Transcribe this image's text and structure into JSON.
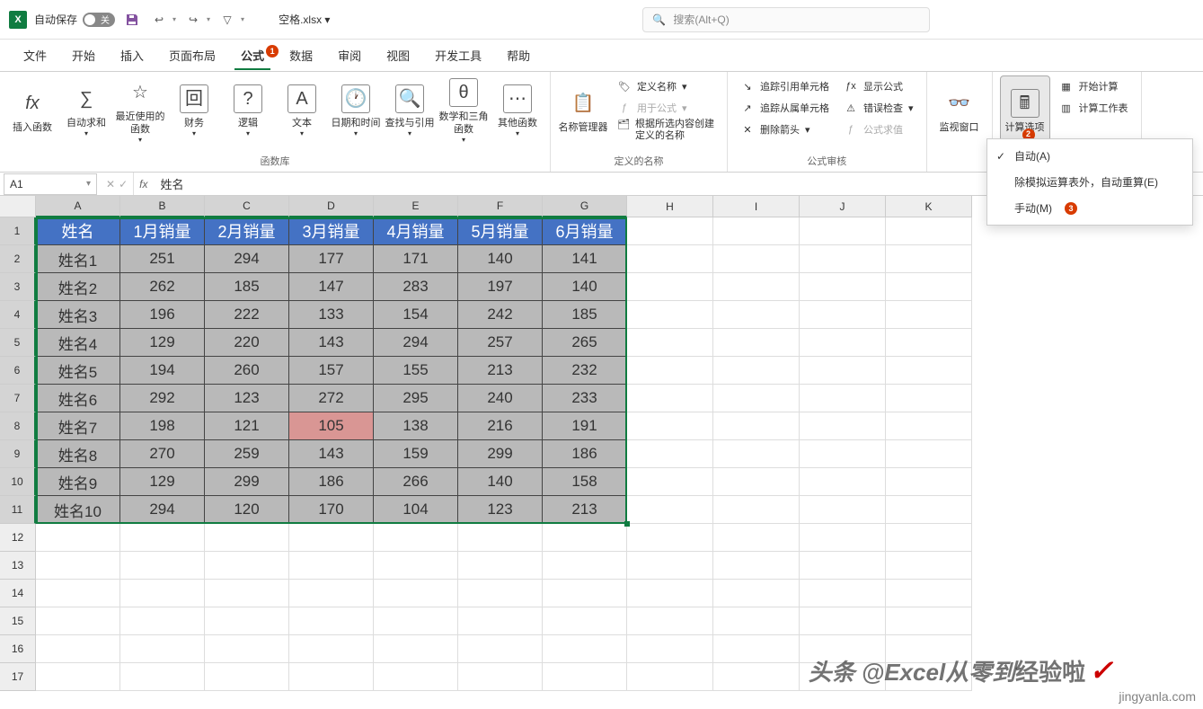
{
  "title_bar": {
    "autosave_label": "自动保存",
    "autosave_state": "关",
    "filename": "空格.xlsx ▾",
    "search_placeholder": "搜索(Alt+Q)"
  },
  "menu": {
    "tabs": [
      "文件",
      "开始",
      "插入",
      "页面布局",
      "公式",
      "数据",
      "审阅",
      "视图",
      "开发工具",
      "帮助"
    ],
    "active_index": 4,
    "badge_on": 4,
    "badge_text": "1"
  },
  "ribbon": {
    "insert_fn": "插入函数",
    "autosum": "自动求和",
    "recent": "最近使用的函数",
    "financial": "财务",
    "logical": "逻辑",
    "text": "文本",
    "datetime": "日期和时间",
    "lookup": "查找与引用",
    "math": "数学和三角函数",
    "more": "其他函数",
    "group_fnlib": "函数库",
    "name_mgr": "名称管理器",
    "define_name": "定义名称",
    "use_in_formula": "用于公式",
    "create_from_sel": "根据所选内容创建定义的名称",
    "group_names": "定义的名称",
    "trace_prec": "追踪引用单元格",
    "trace_dep": "追踪从属单元格",
    "remove_arrows": "删除箭头",
    "show_formulas": "显示公式",
    "error_check": "错误检查",
    "evaluate": "公式求值",
    "group_audit": "公式审核",
    "watch": "监视窗口",
    "calc_options": "计算选项",
    "calc_options_badge": "2",
    "calc_now": "开始计算",
    "calc_sheet": "计算工作表"
  },
  "dropdown": {
    "auto": "自动(A)",
    "except_tables": "除模拟运算表外，自动重算(E)",
    "manual": "手动(M)",
    "manual_badge": "3"
  },
  "formula_bar": {
    "name_box": "A1",
    "formula": "姓名"
  },
  "grid": {
    "col_letters": [
      "A",
      "B",
      "C",
      "D",
      "E",
      "F",
      "G",
      "H",
      "I",
      "J",
      "K"
    ],
    "data_cols": 7,
    "col_width_data": 94,
    "col_width_empty": 96,
    "row_heights": {
      "header": 24,
      "data": 31,
      "empty": 31
    },
    "selected_rows": 11,
    "empty_rows": 6,
    "headers": [
      "姓名",
      "1月销量",
      "2月销量",
      "3月销量",
      "4月销量",
      "5月销量",
      "6月销量"
    ],
    "rows": [
      [
        "姓名1",
        "251",
        "294",
        "177",
        "171",
        "140",
        "141"
      ],
      [
        "姓名2",
        "262",
        "185",
        "147",
        "283",
        "197",
        "140"
      ],
      [
        "姓名3",
        "196",
        "222",
        "133",
        "154",
        "242",
        "185"
      ],
      [
        "姓名4",
        "129",
        "220",
        "143",
        "294",
        "257",
        "265"
      ],
      [
        "姓名5",
        "194",
        "260",
        "157",
        "155",
        "213",
        "232"
      ],
      [
        "姓名6",
        "292",
        "123",
        "272",
        "295",
        "240",
        "233"
      ],
      [
        "姓名7",
        "198",
        "121",
        "105",
        "138",
        "216",
        "191"
      ],
      [
        "姓名8",
        "270",
        "259",
        "143",
        "159",
        "299",
        "186"
      ],
      [
        "姓名9",
        "129",
        "299",
        "186",
        "266",
        "140",
        "158"
      ],
      [
        "姓名10",
        "294",
        "120",
        "170",
        "104",
        "123",
        "213"
      ]
    ],
    "highlight": {
      "row": 6,
      "col": 3
    }
  },
  "watermarks": {
    "w1_a": "头条 @Excel从零到",
    "w1_b": "经验啦",
    "w2": "jingyanla.com"
  }
}
